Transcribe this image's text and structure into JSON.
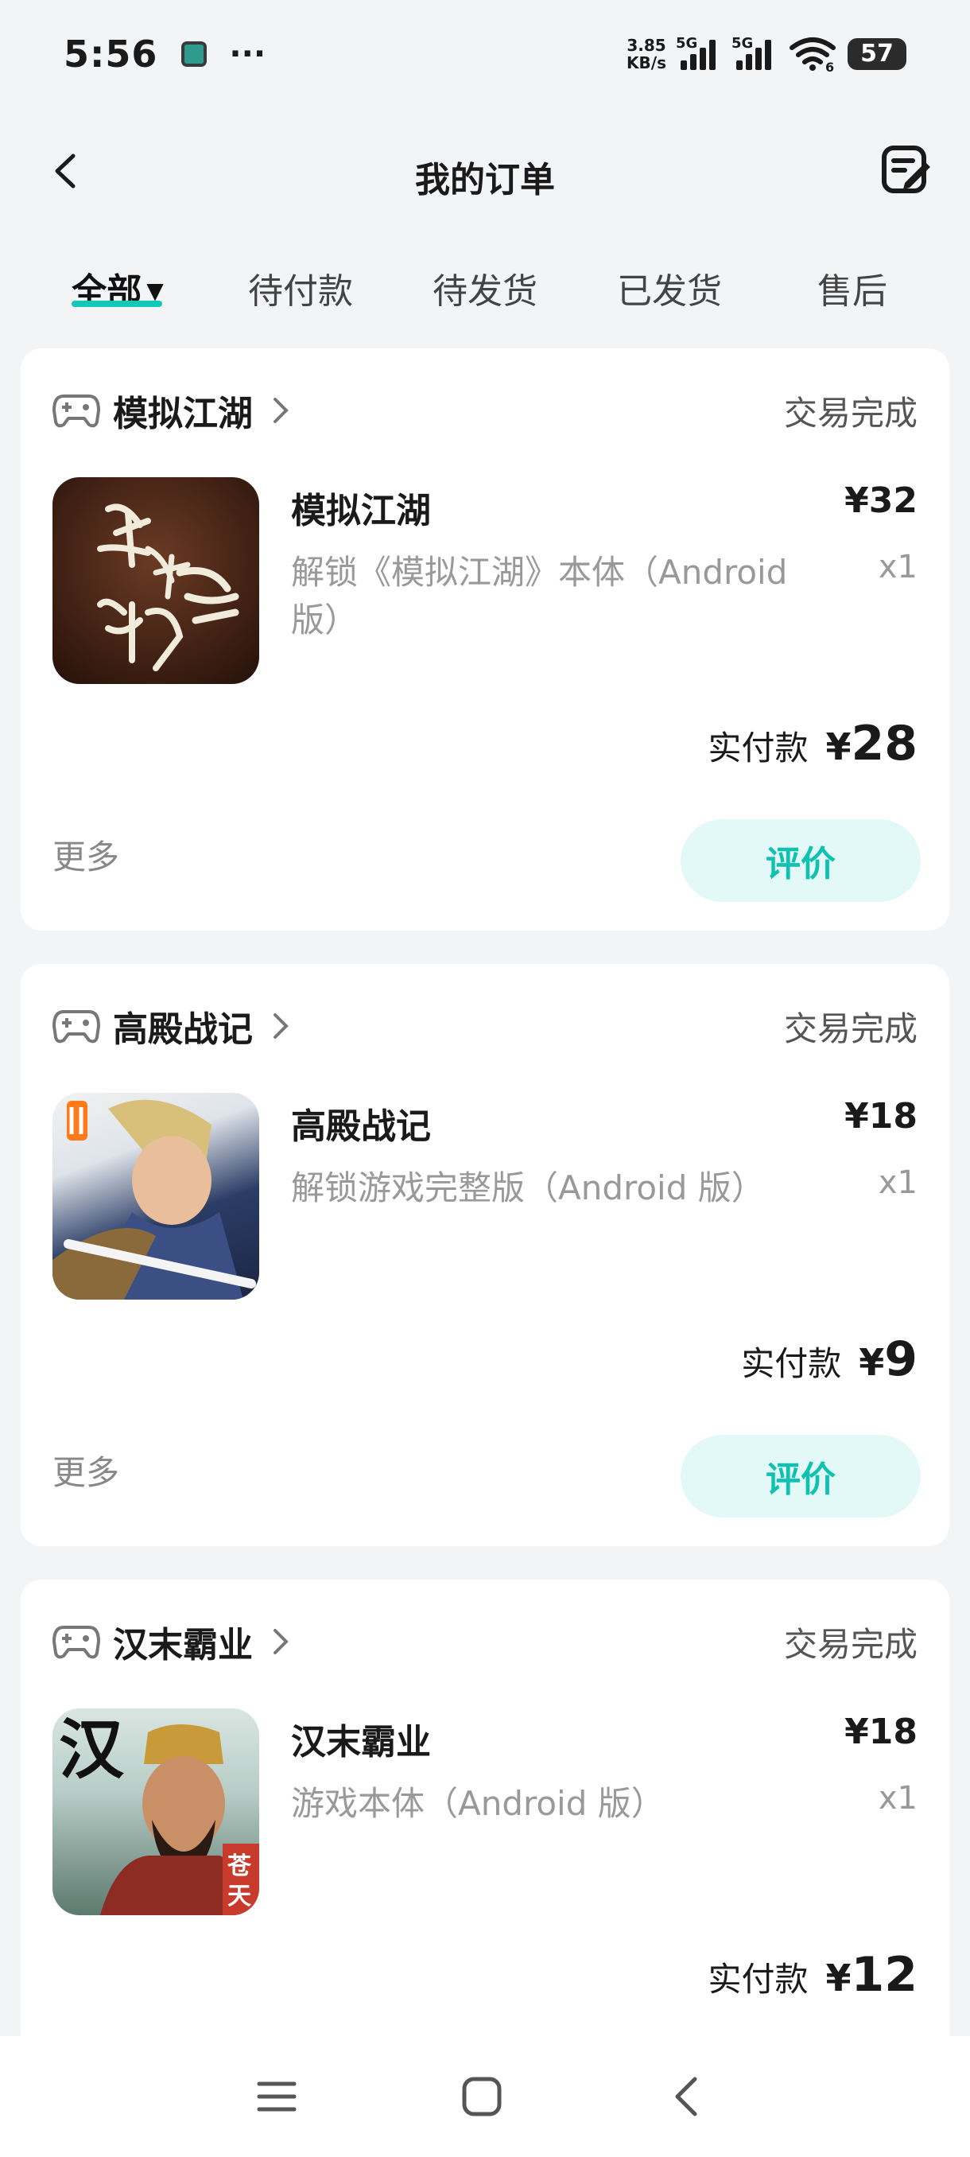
{
  "status_bar": {
    "time": "5:56",
    "dots": "···",
    "net_speed_value": "3.85",
    "net_speed_unit": "KB/s",
    "sim1_label": "5G",
    "sim2_label": "5G",
    "wifi_badge": "6",
    "battery": "57"
  },
  "header": {
    "title": "我的订单",
    "back_icon": "back-arrow-icon",
    "edit_icon": "order-edit-icon"
  },
  "tabs": [
    {
      "label": "全部",
      "active": true
    },
    {
      "label": "待付款",
      "active": false
    },
    {
      "label": "待发货",
      "active": false
    },
    {
      "label": "已发货",
      "active": false
    },
    {
      "label": "售后",
      "active": false
    }
  ],
  "orders": [
    {
      "shop": "模拟江湖",
      "status": "交易完成",
      "item_title": "模拟江湖",
      "price": "¥32",
      "description": "解锁《模拟江湖》本体（Android 版）",
      "quantity": "x1",
      "paid_label": "实付款",
      "paid_currency": "¥",
      "paid_amount": "28",
      "more": "更多",
      "review": "评价"
    },
    {
      "shop": "高殿战记",
      "status": "交易完成",
      "item_title": "高殿战记",
      "price": "¥18",
      "description": "解锁游戏完整版（Android 版）",
      "quantity": "x1",
      "paid_label": "实付款",
      "paid_currency": "¥",
      "paid_amount": "9",
      "more": "更多",
      "review": "评价"
    },
    {
      "shop": "汉末霸业",
      "status": "交易完成",
      "item_title": "汉末霸业",
      "price": "¥18",
      "description": "游戏本体（Android 版）",
      "quantity": "x1",
      "paid_label": "实付款",
      "paid_currency": "¥",
      "paid_amount": "12",
      "thumb_text_1": "汉",
      "thumb_text_2": "苍天"
    }
  ],
  "colors": {
    "accent": "#13c8b8",
    "review_bg": "#e2f9f7",
    "page_bg": "#f3f4f6"
  }
}
